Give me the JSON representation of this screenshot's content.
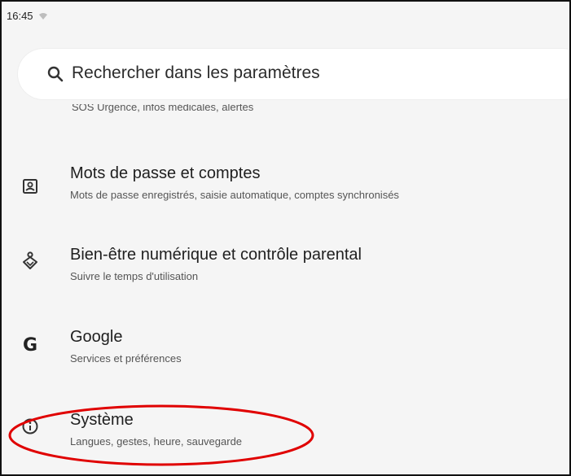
{
  "status_bar": {
    "time": "16:45"
  },
  "search": {
    "placeholder": "Rechercher dans les paramètres"
  },
  "partial_item": {
    "subtitle": "SOS Urgence, infos médicales, alertes"
  },
  "items": [
    {
      "title": "Mots de passe et comptes",
      "subtitle": "Mots de passe enregistrés, saisie automatique, comptes synchronisés",
      "icon": "account-box-icon"
    },
    {
      "title": "Bien-être numérique et contrôle parental",
      "subtitle": "Suivre le temps d'utilisation",
      "icon": "digital-wellbeing-icon"
    },
    {
      "title": "Google",
      "subtitle": "Services et préférences",
      "icon": "google-icon"
    },
    {
      "title": "Système",
      "subtitle": "Langues, gestes, heure, sauvegarde",
      "icon": "info-icon"
    }
  ],
  "annotation": {
    "highlight_color": "#e00000"
  },
  "colors": {
    "background": "#f5f5f5",
    "search_bg": "#ffffff",
    "text": "#1f1f1f",
    "subtext": "#555555"
  }
}
